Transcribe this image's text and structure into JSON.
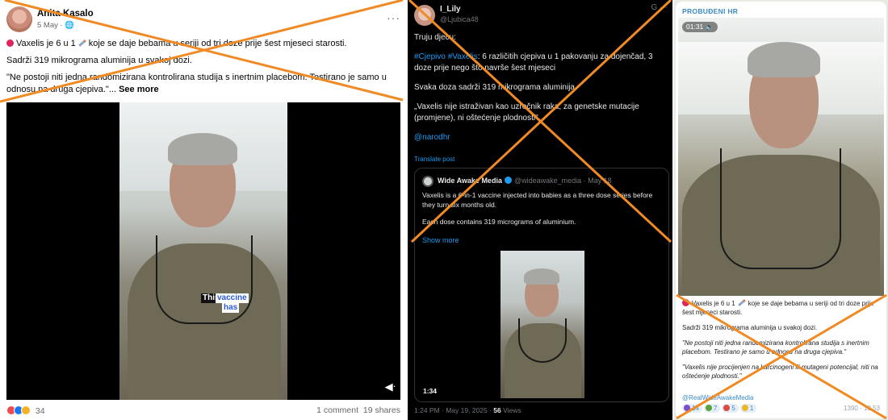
{
  "facebook": {
    "author": "Anita Kasalo",
    "date": "5 May · 🌐",
    "post_lines": [
      "Vaxelis je 6 u 1",
      "koje se daje bebama u seriji od tri doze prije šest mjeseci starosti."
    ],
    "line2": "Sadrži 319 mikrograma aluminija u svakoj dozi.",
    "line3": "\"Ne postoji niti jedna randomizirana kontrolirana studija s inertnim placebom. Testirano je samo u odnosu na druga cjepiva.\"...",
    "see_more": "See more",
    "caption_a": "This",
    "caption_b": "vaccine",
    "caption_c": "has",
    "reaction_count": "34",
    "comments": "1 comment",
    "shares": "19 shares",
    "more_icon": "more-horizontal-icon",
    "volume_icon": "volume-icon"
  },
  "twitter": {
    "name": "I_Lily",
    "handle": "@Ljubica48",
    "corner": "G ···",
    "greeting": "Truju djecu:",
    "tags": "#Cjepivo #Vaxelis",
    "line1_rest": ": 6 različitih cjepiva u 1 pakovanju za dojenčad, 3 doze prije nego što navrše šest mjeseci",
    "line2": "Svaka doza sadrži 319 mikrograma aluminija",
    "line3": "„Vaxelis nije istraživan kao uzročnik raka, za genetske mutacije (promjene), ni oštećenje plodnosti\"",
    "mention": "@narodhr",
    "translate": "Translate post",
    "quote": {
      "name": "Wide Awake Media",
      "handle": "@wideawake_media · May 18",
      "text1": "Vaxelis is a 6-in-1 vaccine injected into babies as a three dose series before they turn six months old.",
      "text2": "Each dose contains 319 micrograms of aluminium.",
      "show_more": "Show more",
      "video_time": "1:34"
    },
    "meta_time": "1:24 PM · May 19, 2025 · ",
    "meta_views_num": "56",
    "meta_views_label": " Views"
  },
  "telegram": {
    "channel": "PROBUĐENI HR",
    "video_time": "01:31 🔈",
    "p1a": "Vaxelis je 6 u 1",
    "p1b": "koje se daje bebama u seriji od tri doze prije šest mjeseci starosti.",
    "p2": "Sadrži 319 mikrograma aluminija u svakoj dozi.",
    "p3": "\"Ne postoji niti jedna randomizirana kontrolirana studija s inertnim placebom. Testirano je samo u odnosu na druga cjepiva.\"",
    "p4": "\"Vaxelis nije procijenjen na karcinogeni ili mutageni potencijal, niti na oštećenje plodnosti.\"",
    "link": "@RealWideAwakeMedia",
    "reactions": [
      {
        "count": "14",
        "color": "#7c4dd1"
      },
      {
        "count": "7",
        "color": "#5aa33a"
      },
      {
        "count": "5",
        "color": "#d94b3c"
      },
      {
        "count": "1",
        "color": "#f0b429"
      }
    ],
    "views": "1390 · 13:53"
  },
  "colors": {
    "cross": "#f08a24",
    "fb_reaction_1": "#f0484e",
    "fb_reaction_2": "#1877f2",
    "fb_reaction_3": "#f7b125"
  }
}
